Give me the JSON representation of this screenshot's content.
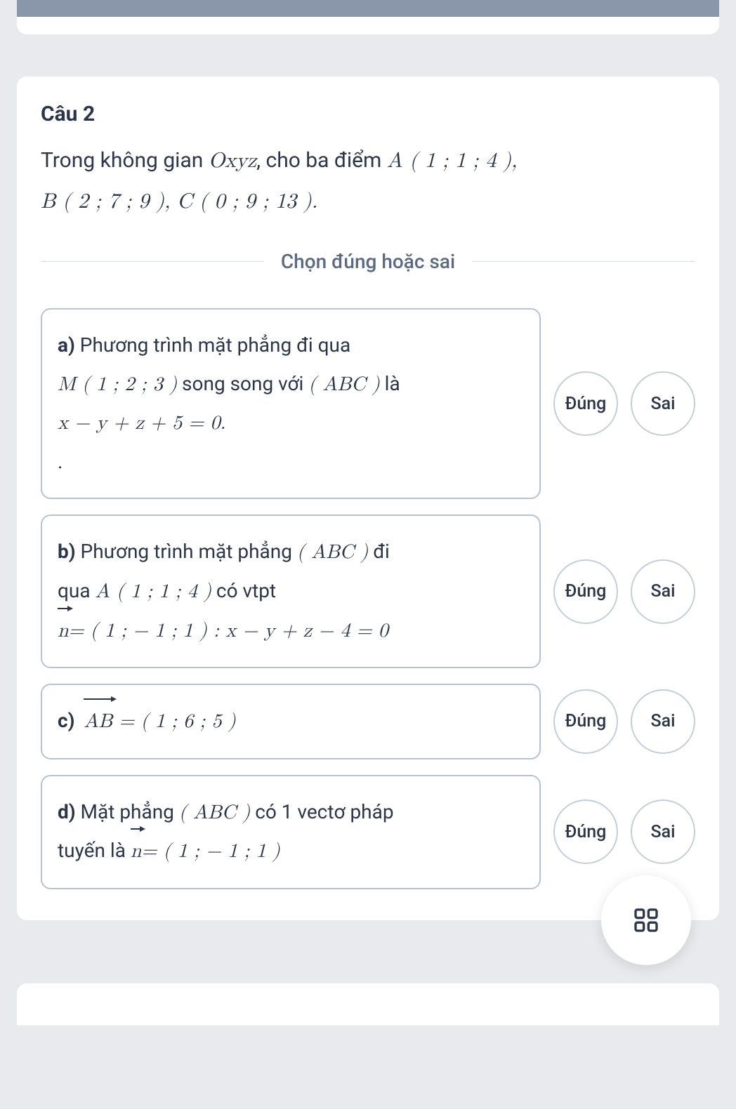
{
  "question": {
    "title": "Câu 2",
    "prompt_pre": "Trong không gian ",
    "prompt_space": "Oxyz",
    "prompt_mid": ", cho ba điểm ",
    "pointA": "A ( 1 ; 1 ; 4 )",
    "pointB": "B ( 2 ; 7 ; 9 )",
    "pointC": "C ( 0 ; 9 ; 13 )",
    "divider": "Chọn đúng hoặc sai"
  },
  "buttons": {
    "true": "Đúng",
    "false": "Sai"
  },
  "options": {
    "a": {
      "label": "a)",
      "line1": " Phương trình mặt phẳng đi qua",
      "m_point": "M ( 1 ; 2 ; 3 )",
      "mid": " song song với ",
      "abc": "( ABC )",
      "end": " là",
      "eq": "x − y + z + 5 = 0.",
      "dot": "."
    },
    "b": {
      "label": "b)",
      "line1": " Phương trình mặt phẳng ",
      "abc": "( ABC )",
      "mid1": " đi",
      "line2_pre": "qua ",
      "a_point": "A ( 1 ; 1 ; 4 )",
      "mid2": " có vtpt",
      "n_vec": "n",
      "eq": "= ( 1 ; − 1 ; 1 ) : x − y + z − 4 = 0"
    },
    "c": {
      "label": "c)",
      "ab_vec": "AB",
      "eq": " = ( 1 ; 6 ; 5 )"
    },
    "d": {
      "label": "d)",
      "line1": " Mặt phẳng ",
      "abc": "( ABC )",
      "mid": " có 1 vectơ pháp",
      "line2_pre": "tuyến là ",
      "n_vec": "n",
      "eq": "= ( 1 ; − 1 ; 1 )"
    }
  }
}
